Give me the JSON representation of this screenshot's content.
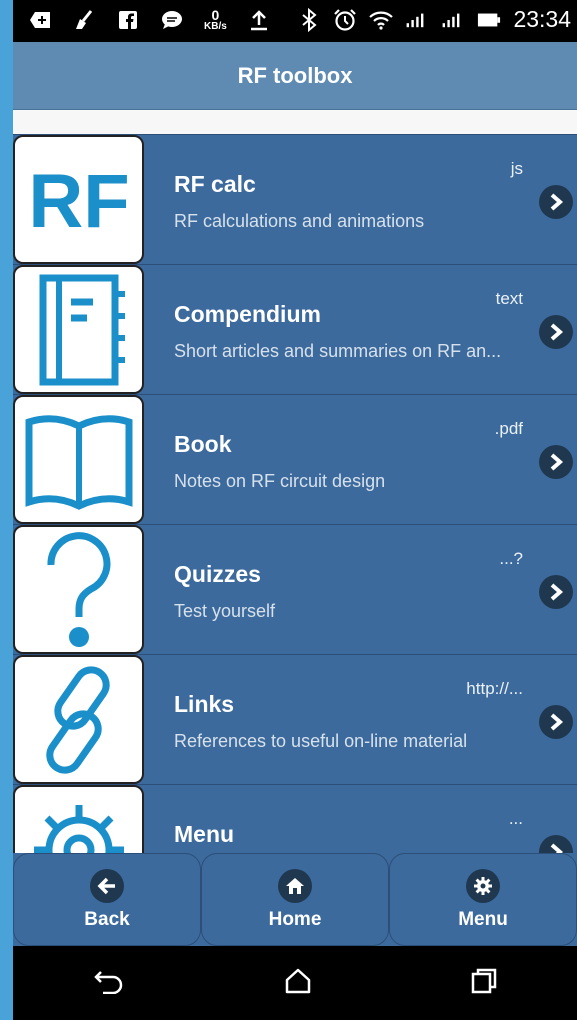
{
  "status_bar": {
    "speed_value": "0",
    "speed_unit": "KB/s",
    "time": "23:34",
    "icons": [
      "plus-tab-icon",
      "broom-icon",
      "facebook-icon",
      "chat-icon",
      "upload-icon",
      "bluetooth-icon",
      "alarm-icon",
      "wifi-icon",
      "signal-icon",
      "signal-icon",
      "battery-icon"
    ]
  },
  "header": {
    "title": "RF toolbox"
  },
  "items": [
    {
      "title": "RF calc",
      "desc": "RF calculations and animations",
      "aside": "js",
      "icon": "rf-logo-icon"
    },
    {
      "title": "Compendium",
      "desc": "Short articles and summaries on RF an...",
      "aside": "text",
      "icon": "notebook-icon"
    },
    {
      "title": "Book",
      "desc": "Notes on RF circuit design",
      "aside": ".pdf",
      "icon": "open-book-icon"
    },
    {
      "title": "Quizzes",
      "desc": "Test yourself",
      "aside": "...?",
      "icon": "question-mark-icon"
    },
    {
      "title": "Links",
      "desc": "References to useful on-line material",
      "aside": "http://...",
      "icon": "chain-link-icon"
    },
    {
      "title": "Menu",
      "desc": "",
      "aside": "...",
      "icon": "gear-icon"
    }
  ],
  "bottom_nav": [
    {
      "label": "Back",
      "icon": "arrow-left-icon"
    },
    {
      "label": "Home",
      "icon": "home-icon"
    },
    {
      "label": "Menu",
      "icon": "gear-icon"
    }
  ],
  "system_nav": [
    "back-icon",
    "home-outline-icon",
    "recents-icon"
  ],
  "colors": {
    "accent": "#1b8fc9",
    "list_bg": "#3d6a9c",
    "header_bg": "#5f8bb3"
  }
}
